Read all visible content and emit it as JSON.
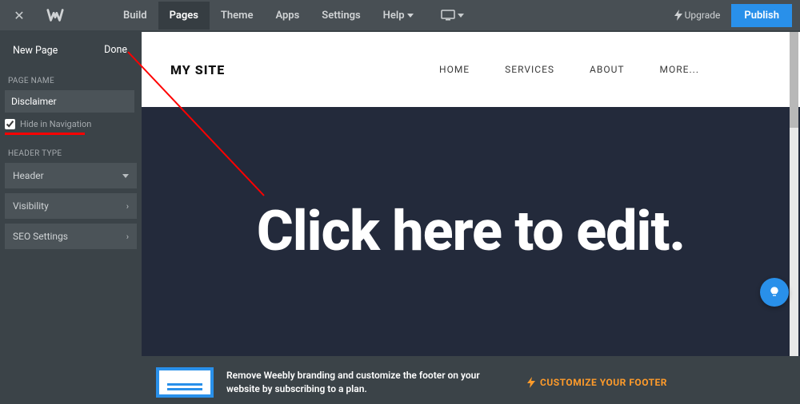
{
  "topbar": {
    "close": "✕",
    "nav": [
      "Build",
      "Pages",
      "Theme",
      "Apps",
      "Settings"
    ],
    "active_nav_index": 1,
    "help": "Help",
    "upgrade": "Upgrade",
    "publish": "Publish"
  },
  "sidebar": {
    "new_page": "New Page",
    "done": "Done",
    "page_name_label": "PAGE NAME",
    "page_name_value": "Disclaimer",
    "hide_nav_label": "Hide in Navigation",
    "hide_nav_checked": true,
    "header_type_label": "HEADER TYPE",
    "header_select": "Header",
    "visibility": "Visibility",
    "seo": "SEO Settings"
  },
  "site": {
    "title": "MY SITE",
    "nav": [
      "HOME",
      "SERVICES",
      "ABOUT",
      "MORE..."
    ],
    "hero_text": "Click here to edit."
  },
  "footer": {
    "text": "Remove Weebly branding and customize the footer on your website by subscribing to a plan.",
    "cta": "CUSTOMIZE YOUR FOOTER"
  }
}
